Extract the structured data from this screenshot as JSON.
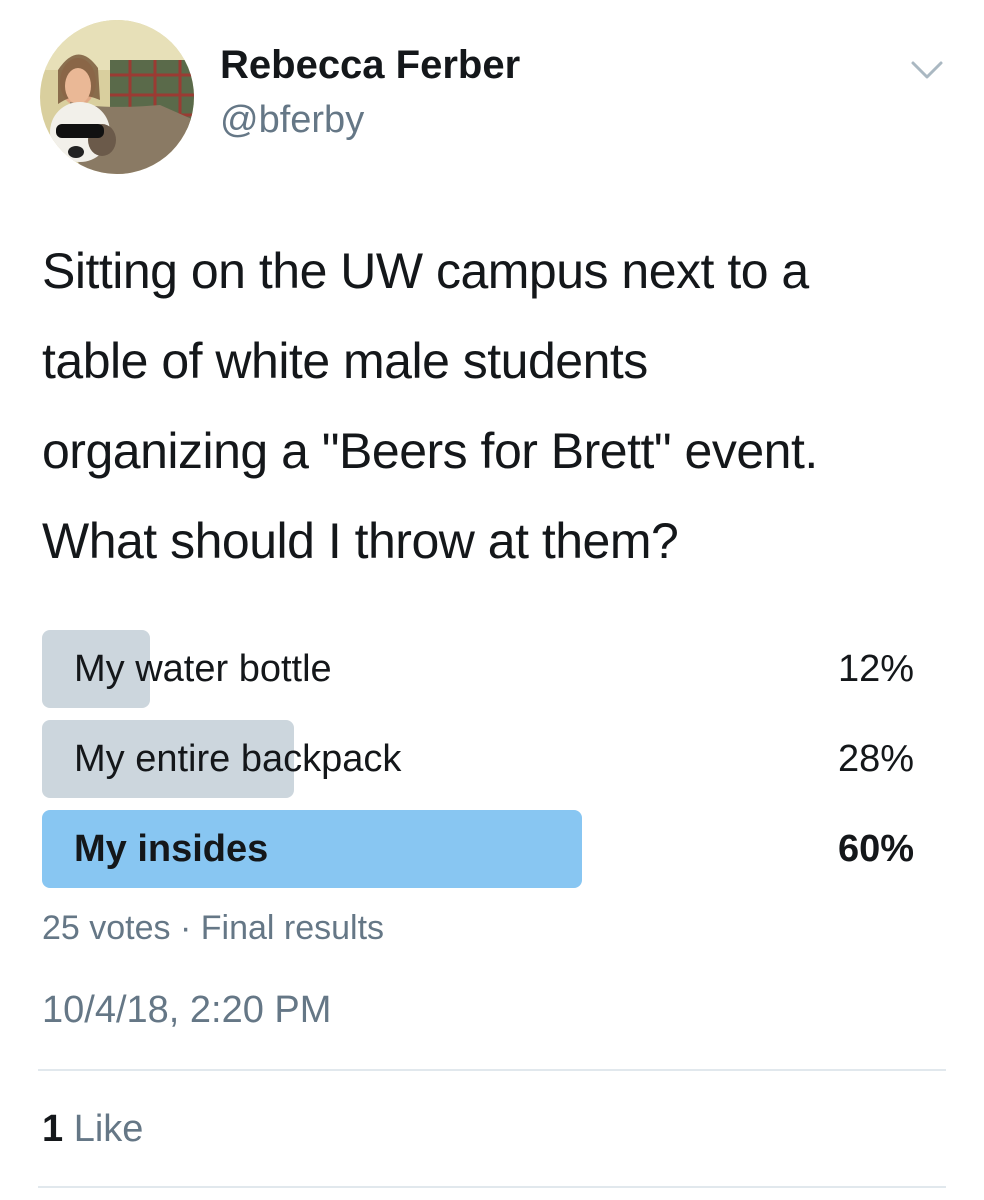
{
  "author": {
    "name": "Rebecca Ferber",
    "handle": "@bferby"
  },
  "header": {
    "menu_icon": "chevron-down-icon"
  },
  "tweet": {
    "text_lines": [
      "Sitting on the UW campus next to a",
      "table of white male students",
      "organizing a \"Beers for Brett\" event.",
      "What should I throw at them?"
    ]
  },
  "poll": {
    "options": [
      {
        "label": "My water bottle",
        "percent_label": "12%",
        "percent": 12,
        "winner": false
      },
      {
        "label": "My entire backpack",
        "percent_label": "28%",
        "percent": 28,
        "winner": false
      },
      {
        "label": "My insides",
        "percent_label": "60%",
        "percent": 60,
        "winner": true
      }
    ],
    "votes": "25 votes",
    "separator": "·",
    "status": "Final results"
  },
  "timestamp": "10/4/18, 2:20 PM",
  "engagement": {
    "like_count": "1",
    "like_label": "Like"
  },
  "colors": {
    "bar_default": "#ccd6dd",
    "bar_winner": "#88c6f2",
    "text_primary": "#14171a",
    "text_secondary": "#657786",
    "divider": "#e1e8ed"
  }
}
